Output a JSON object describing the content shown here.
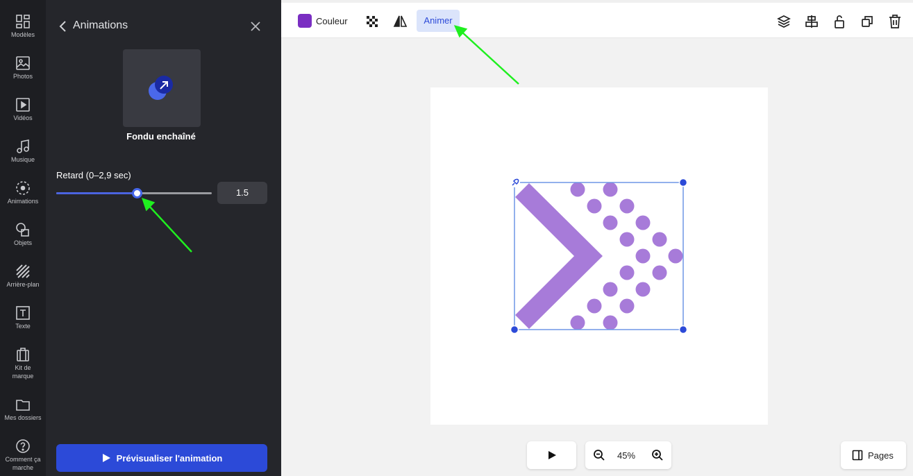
{
  "rail": {
    "items": [
      {
        "label": "Modèles",
        "icon": "templates-icon"
      },
      {
        "label": "Photos",
        "icon": "photo-icon"
      },
      {
        "label": "Vidéos",
        "icon": "video-icon"
      },
      {
        "label": "Musique",
        "icon": "music-icon"
      },
      {
        "label": "Animations",
        "icon": "animation-icon"
      },
      {
        "label": "Objets",
        "icon": "shapes-icon"
      },
      {
        "label": "Arrière-plan",
        "icon": "background-icon"
      },
      {
        "label": "Texte",
        "icon": "text-icon"
      },
      {
        "label": "Kit de marque",
        "icon": "brand-kit-icon"
      },
      {
        "label": "Mes dossiers",
        "icon": "folder-icon"
      },
      {
        "label": "Comment ça marche",
        "icon": "help-icon"
      }
    ]
  },
  "panel": {
    "title": "Animations",
    "animation_name": "Fondu enchaîné",
    "delay_label": "Retard (0–2,9 sec)",
    "delay_value": "1.5",
    "delay_fraction": 0.517,
    "preview_label": "Prévisualiser l'animation"
  },
  "toolbar": {
    "color_label": "Couleur",
    "color_value": "#7a2ec2",
    "animate_label": "Animer"
  },
  "zoom": {
    "level": "45%"
  },
  "pages": {
    "label": "Pages"
  },
  "colors": {
    "accent": "#2c4ad8",
    "shape": "#a77bd9",
    "selection": "#6f95e6",
    "annotation": "#1fef1f"
  }
}
